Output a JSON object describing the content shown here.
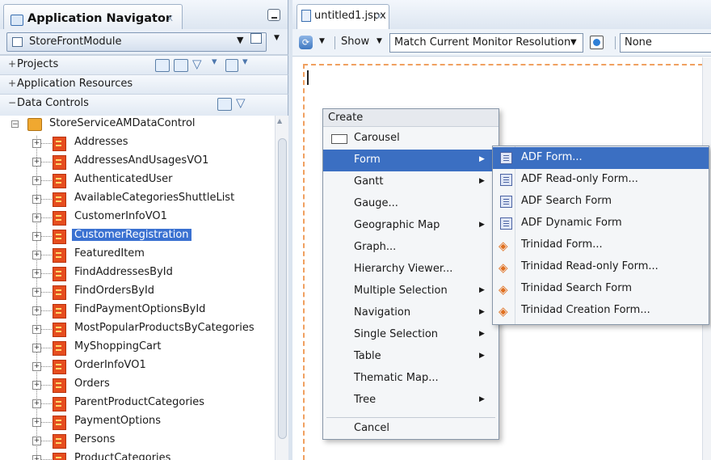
{
  "navigator": {
    "tab_title": "Application Navigator",
    "tab_close": "x",
    "module": "StoreFrontModule",
    "sections": {
      "projects": "Projects",
      "app_resources": "Application Resources",
      "data_controls": "Data Controls"
    },
    "tree": {
      "root": "StoreServiceAMDataControl",
      "items": [
        "Addresses",
        "AddressesAndUsagesVO1",
        "AuthenticatedUser",
        "AvailableCategoriesShuttleList",
        "CustomerInfoVO1",
        "CustomerRegistration",
        "FeaturedItem",
        "FindAddressesById",
        "FindOrdersById",
        "FindPaymentOptionsById",
        "MostPopularProductsByCategories",
        "MyShoppingCart",
        "OrderInfoVO1",
        "Orders",
        "ParentProductCategories",
        "PaymentOptions",
        "Persons",
        "ProductCategories"
      ],
      "selected": "CustomerRegistration"
    }
  },
  "editor": {
    "tab_title": "untitled1.jspx",
    "tab_close": "x",
    "toolbar": {
      "show_label": "Show",
      "resolution": "Match Current Monitor Resolution",
      "none_value": "None"
    }
  },
  "create_menu": {
    "header": "Create",
    "items": [
      {
        "label": "Carousel",
        "submenu": false
      },
      {
        "label": "Form",
        "submenu": true,
        "active": true
      },
      {
        "label": "Gantt",
        "submenu": true
      },
      {
        "label": "Gauge...",
        "submenu": false
      },
      {
        "label": "Geographic Map",
        "submenu": true
      },
      {
        "label": "Graph...",
        "submenu": false
      },
      {
        "label": "Hierarchy Viewer...",
        "submenu": false
      },
      {
        "label": "Multiple Selection",
        "submenu": true
      },
      {
        "label": "Navigation",
        "submenu": true
      },
      {
        "label": "Single Selection",
        "submenu": true
      },
      {
        "label": "Table",
        "submenu": true
      },
      {
        "label": "Thematic Map...",
        "submenu": false
      },
      {
        "label": "Tree",
        "submenu": true
      }
    ],
    "cancel": "Cancel"
  },
  "form_submenu": {
    "items": [
      {
        "label": "ADF Form...",
        "icon": "adf-form-icon",
        "active": true
      },
      {
        "label": "ADF Read-only Form...",
        "icon": "adf-form-icon"
      },
      {
        "label": "ADF Search Form",
        "icon": "adf-form-icon"
      },
      {
        "label": "ADF Dynamic Form",
        "icon": "adf-form-icon"
      },
      {
        "label": "Trinidad Form...",
        "icon": "trinidad-icon"
      },
      {
        "label": "Trinidad Read-only Form...",
        "icon": "trinidad-icon"
      },
      {
        "label": "Trinidad Search Form",
        "icon": "trinidad-icon"
      },
      {
        "label": "Trinidad Creation Form...",
        "icon": "trinidad-icon"
      }
    ]
  },
  "colors": {
    "selection": "#3a71d1",
    "menu_highlight": "#3b6fc2",
    "canvas_border": "#f0a060"
  }
}
